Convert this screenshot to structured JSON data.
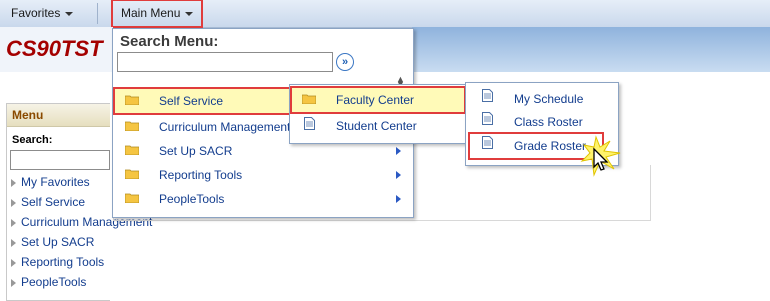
{
  "topbar": {
    "favorites": "Favorites",
    "main_menu": "Main Menu"
  },
  "banner": {
    "title": "CS90TST"
  },
  "pagelet": {
    "title": "Menu",
    "search_label": "Search:",
    "items": [
      "My Favorites",
      "Self Service",
      "Curriculum Management",
      "Set Up SACR",
      "Reporting Tools",
      "PeopleTools"
    ]
  },
  "main_menu": {
    "search_label": "Search Menu:",
    "search_value": "",
    "items": [
      "Self Service",
      "Curriculum Management",
      "Set Up SACR",
      "Reporting Tools",
      "PeopleTools"
    ]
  },
  "self_service_menu": {
    "items": [
      "Faculty Center",
      "Student Center"
    ]
  },
  "faculty_center_menu": {
    "items": [
      "My Schedule",
      "Class Roster",
      "Grade Roster"
    ]
  },
  "colors": {
    "highlight": "#e03c3c",
    "link": "#133d8e",
    "folder": "#f5c542",
    "brand": "#a40000"
  },
  "icons": {
    "folder": "folder-icon",
    "document": "document-icon",
    "go": "go-arrow-icon",
    "cursor": "mouse-cursor-icon"
  }
}
